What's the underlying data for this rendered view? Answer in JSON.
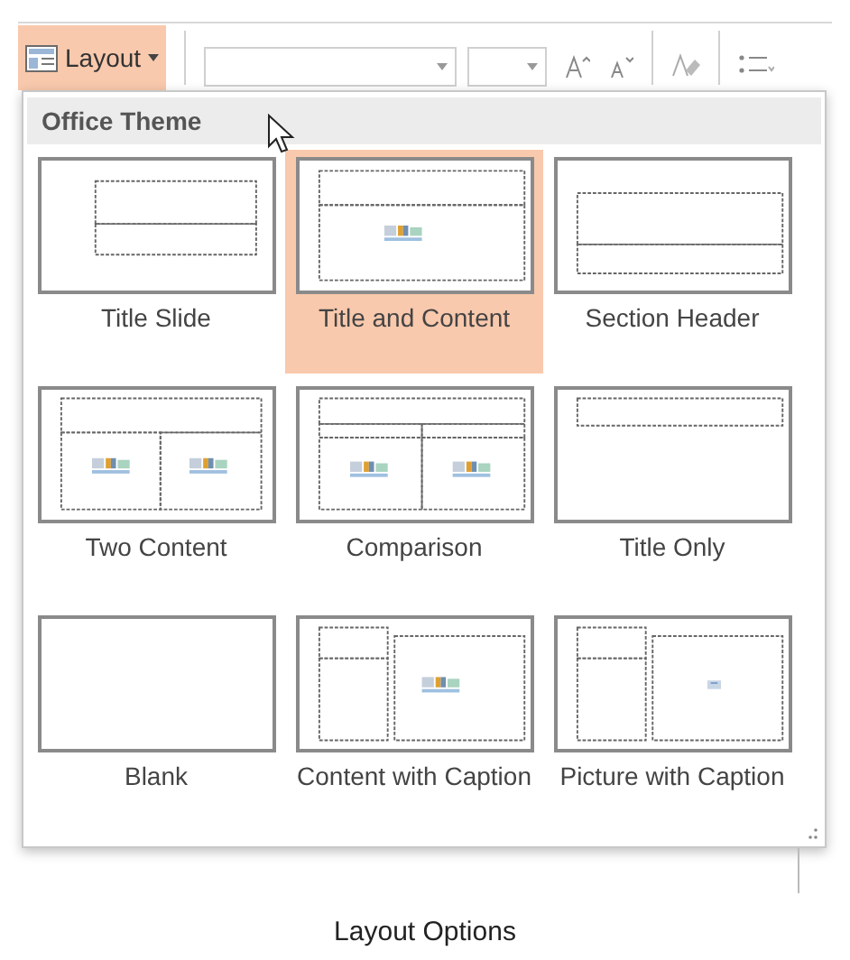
{
  "toolbar": {
    "layout_button": {
      "label": "Layout",
      "selected": true
    }
  },
  "gallery": {
    "header": "Office Theme",
    "layouts": [
      {
        "label": "Title Slide",
        "kind": "title",
        "selected": false
      },
      {
        "label": "Title and Content",
        "kind": "title_content",
        "selected": true
      },
      {
        "label": "Section Header",
        "kind": "section",
        "selected": false
      },
      {
        "label": "Two Content",
        "kind": "two_content",
        "selected": false
      },
      {
        "label": "Comparison",
        "kind": "comparison",
        "selected": false
      },
      {
        "label": "Title Only",
        "kind": "title_only",
        "selected": false
      },
      {
        "label": "Blank",
        "kind": "blank",
        "selected": false
      },
      {
        "label": "Content with Caption",
        "kind": "content_caption",
        "selected": false
      },
      {
        "label": "Picture with Caption",
        "kind": "picture_caption",
        "selected": false
      }
    ]
  },
  "caption": "Layout Options"
}
